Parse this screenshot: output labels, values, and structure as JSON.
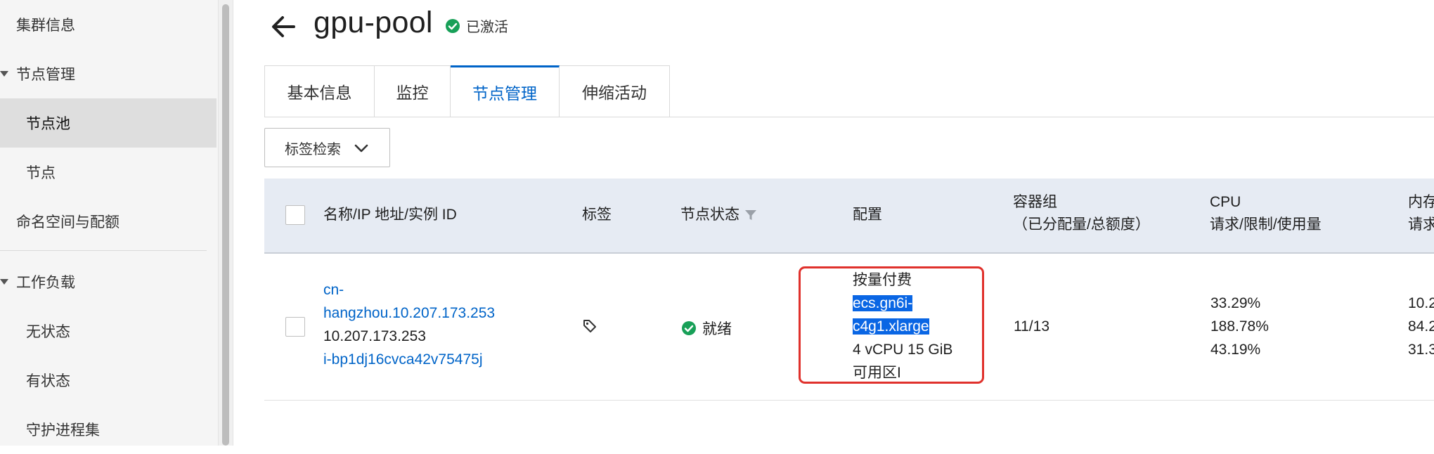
{
  "sidebar": {
    "items": [
      {
        "label": "集群信息"
      },
      {
        "label": "节点管理"
      },
      {
        "label": "节点池"
      },
      {
        "label": "节点"
      },
      {
        "label": "命名空间与配额"
      },
      {
        "label": "工作负载"
      },
      {
        "label": "无状态"
      },
      {
        "label": "有状态"
      },
      {
        "label": "守护进程集"
      }
    ]
  },
  "header": {
    "title": "gpu-pool",
    "status": "已激活",
    "status_color": "#18a058"
  },
  "tabs": [
    {
      "label": "基本信息"
    },
    {
      "label": "监控"
    },
    {
      "label": "节点管理"
    },
    {
      "label": "伸缩活动"
    }
  ],
  "tag_search": {
    "label": "标签检索"
  },
  "table": {
    "columns": {
      "name": "名称/IP 地址/实例 ID",
      "tags": "标签",
      "status": "节点状态",
      "config": "配置",
      "pods_line1": "容器组",
      "pods_line2": "（已分配量/总额度）",
      "cpu_line1": "CPU",
      "cpu_line2": "请求/限制/使用量",
      "mem_line1": "内存",
      "mem_line2": "请求"
    },
    "rows": [
      {
        "name_line1": "cn-",
        "name_line2": "hangzhou.10.207.173.253",
        "ip": "10.207.173.253",
        "instance_id": "i-bp1dj16cvca42v75475j",
        "status": "就绪",
        "config_billing": "按量付费",
        "config_type_line1": "ecs.gn6i-",
        "config_type_line2": "c4g1.xlarge",
        "config_spec": "4 vCPU 15 GiB",
        "config_zone": "可用区I",
        "pods": "11/13",
        "cpu_request": "33.29%",
        "cpu_limit": "188.78%",
        "cpu_usage": "43.19%",
        "mem_request": "10.2",
        "mem_limit": "84.2",
        "mem_usage": "31.3"
      }
    ]
  },
  "colors": {
    "accent": "#0064c8",
    "highlight_border": "#e0312c",
    "selection": "#0a66e4"
  }
}
